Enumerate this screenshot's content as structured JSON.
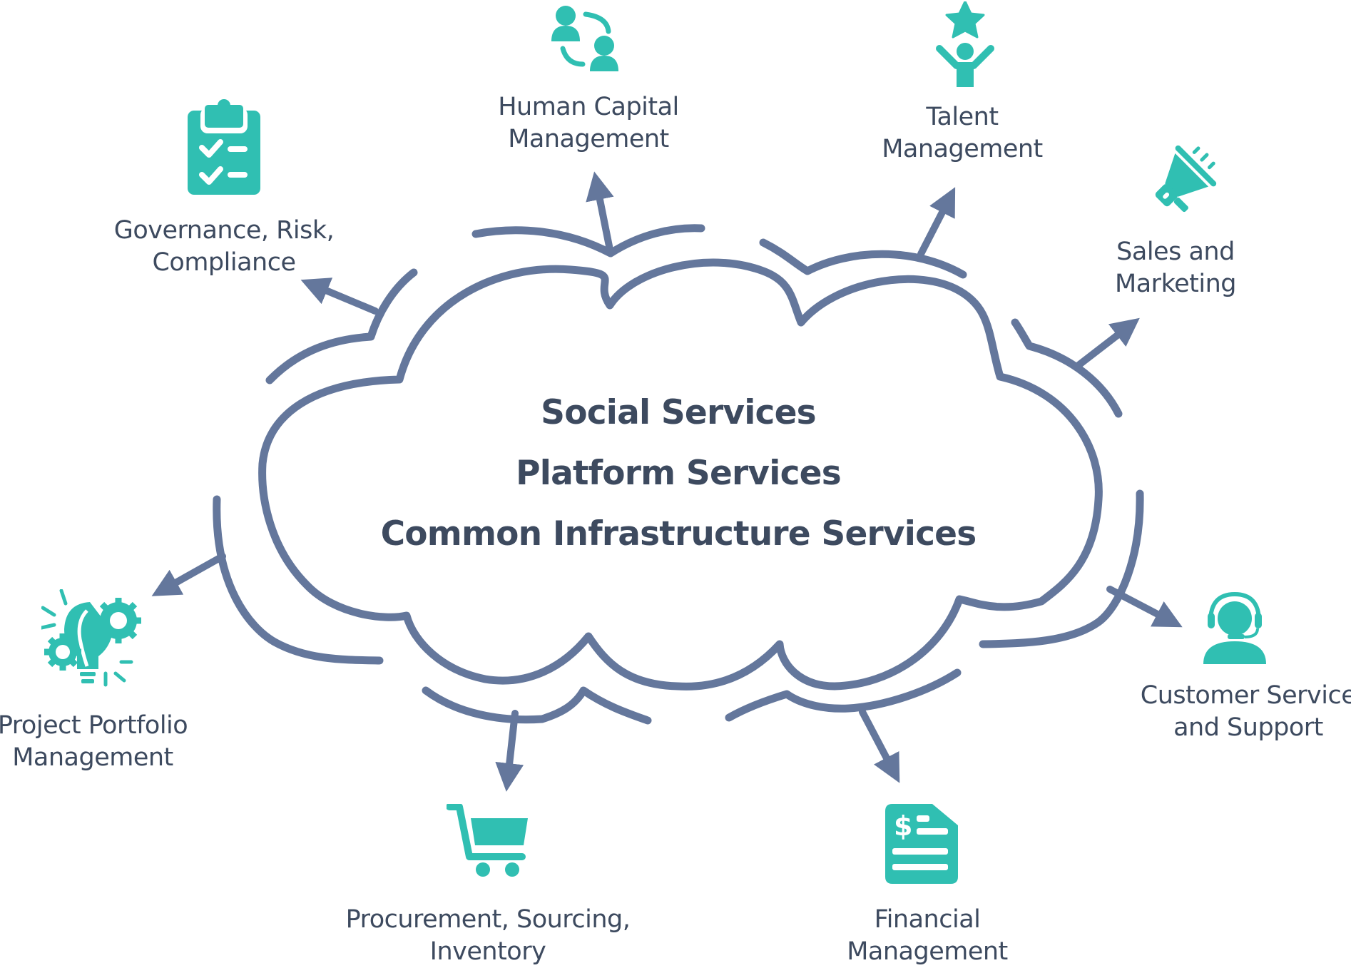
{
  "diagram": {
    "colors": {
      "stroke": "#64779c",
      "icon": "#30bfb2",
      "text": "#3d4a5f",
      "background": "#ffffff"
    },
    "center": {
      "lines": [
        "Social Services",
        "Platform Services",
        "Common Infrastructure Services"
      ]
    },
    "modules": [
      {
        "id": "grc",
        "icon": "clipboard-checklist-icon",
        "lines": [
          "Governance, Risk,",
          "Compliance"
        ]
      },
      {
        "id": "hcm",
        "icon": "people-exchange-icon",
        "lines": [
          "Human Capital",
          "Management"
        ]
      },
      {
        "id": "talent",
        "icon": "person-star-icon",
        "lines": [
          "Talent",
          "Management"
        ]
      },
      {
        "id": "sales",
        "icon": "megaphone-icon",
        "lines": [
          "Sales and",
          "Marketing"
        ]
      },
      {
        "id": "customer",
        "icon": "headset-agent-icon",
        "lines": [
          "Customer Service",
          "and Support"
        ]
      },
      {
        "id": "financial",
        "icon": "invoice-dollar-icon",
        "lines": [
          "Financial",
          "Management"
        ]
      },
      {
        "id": "procurement",
        "icon": "shopping-cart-icon",
        "lines": [
          "Procurement, Sourcing,",
          "Inventory"
        ]
      },
      {
        "id": "ppm",
        "icon": "lightbulb-gears-icon",
        "lines": [
          "Project Portfolio",
          "Management"
        ]
      }
    ]
  }
}
